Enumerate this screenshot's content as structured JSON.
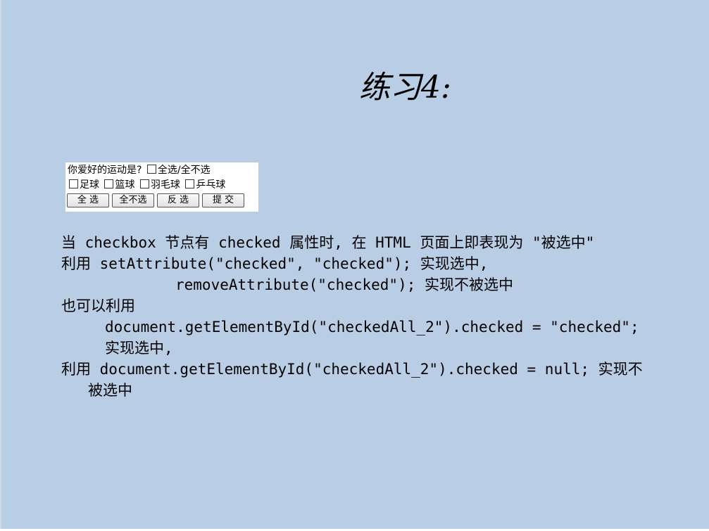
{
  "slide": {
    "title": "练习4:",
    "demo": {
      "question": "你爱好的运动是?",
      "select_all_label": "全选/全不选",
      "options": [
        "足球",
        "篮球",
        "羽毛球",
        "乒乓球"
      ],
      "buttons": [
        "全 选",
        "全不选",
        "反 选",
        "提 交"
      ]
    },
    "lines": [
      "当 checkbox 节点有 checked 属性时, 在 HTML 页面上即表现为 \"被选中\"",
      "利用 setAttribute(\"checked\", \"checked\"); 实现选中,",
      "removeAttribute(\"checked\"); 实现不被选中",
      "也可以利用",
      "document.getElementById(\"checkedAll_2\").checked = \"checked\";",
      "实现选中,",
      "利用 document.getElementById(\"checkedAll_2\").checked = null; 实现不",
      "被选中"
    ]
  },
  "colors": {
    "background": "#b9cde5",
    "text": "#000000"
  }
}
